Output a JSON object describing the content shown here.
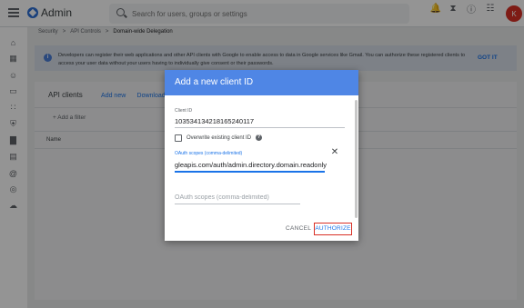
{
  "app": {
    "title": "Admin"
  },
  "search": {
    "placeholder": "Search for users, groups or settings"
  },
  "topbar": {
    "icons": [
      "bell-icon",
      "hourglass-icon",
      "help-icon",
      "apps-grid-icon"
    ],
    "avatar_letter": "K"
  },
  "rail": {
    "icons": [
      "home-icon",
      "dashboard-icon",
      "users-icon",
      "devices-icon",
      "apps-icon",
      "security-icon",
      "reports-icon",
      "billing-icon",
      "account-icon",
      "rules-icon",
      "storage-icon"
    ]
  },
  "breadcrumb": {
    "items": [
      "Security",
      "API Controls",
      "Domain-wide Delegation"
    ],
    "separator": ">"
  },
  "banner": {
    "text": "Developers can register their web applications and other API clients with Google to enable access to data in Google services like Gmail. You can authorize these registered clients to access your user data without your users having to individually give consent or their passwords.",
    "action": "GOT IT"
  },
  "card": {
    "title": "API clients",
    "add_new": "Add new",
    "download": "Download cli",
    "add_filter": "+ Add a filter",
    "column_name": "Name"
  },
  "dialog": {
    "title": "Add a new client ID",
    "client_id_label": "Client ID",
    "client_id_value": "103534134218165240117",
    "overwrite_label": "Overwrite existing client ID",
    "scopes_label": "OAuth scopes (comma-delimited)",
    "scopes_value": "gleapis.com/auth/admin.directory.domain.readonly",
    "scopes_placeholder": "OAuth scopes (comma-delimited)",
    "cancel_label": "CANCEL",
    "authorize_label": "AUTHORIZE"
  },
  "colors": {
    "dialog_header": "#4f86e5",
    "accent_blue": "#1a73e8",
    "highlight_red": "#d93025"
  }
}
